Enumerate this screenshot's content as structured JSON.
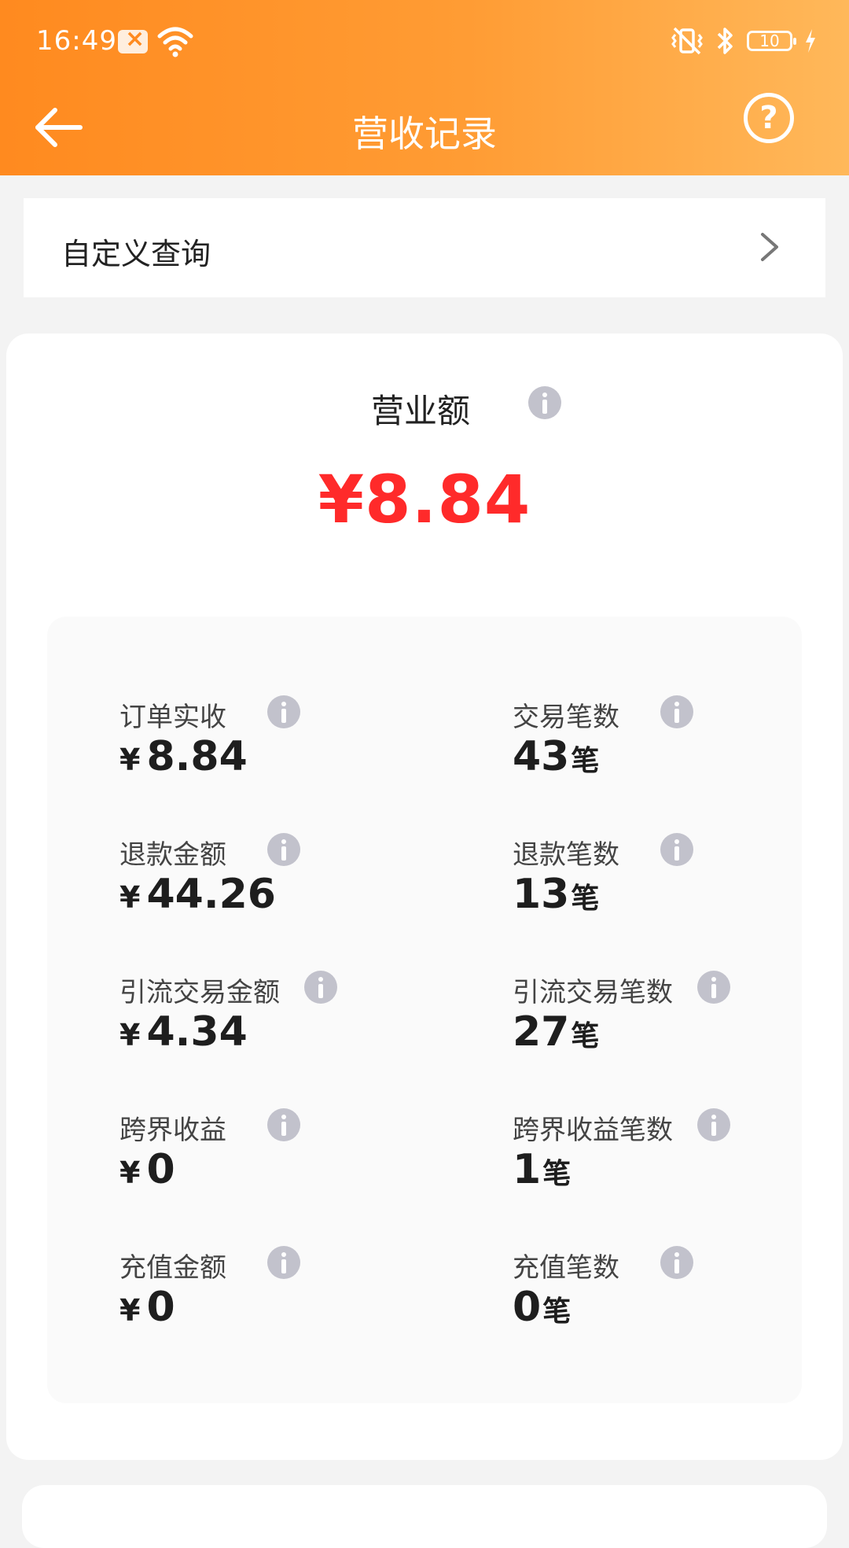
{
  "status_bar": {
    "time": "16:49",
    "battery_level": "10"
  },
  "header": {
    "title": "营收记录",
    "help_label": "?"
  },
  "custom_query": {
    "label": "自定义查询"
  },
  "revenue": {
    "title": "营业额",
    "amount": "¥8.84"
  },
  "stats": {
    "left": [
      {
        "label": "订单实收",
        "yen": "¥",
        "value": "8.84"
      },
      {
        "label": "退款金额",
        "yen": "¥",
        "value": "44.26"
      },
      {
        "label": "引流交易金额",
        "yen": "¥",
        "value": "4.34"
      },
      {
        "label": "跨界收益",
        "yen": "¥",
        "value": "0"
      },
      {
        "label": "充值金额",
        "yen": "¥",
        "value": "0"
      }
    ],
    "right": [
      {
        "label": "交易笔数",
        "value": "43",
        "unit": "笔"
      },
      {
        "label": "退款笔数",
        "value": "13",
        "unit": "笔"
      },
      {
        "label": "引流交易笔数",
        "value": "27",
        "unit": "笔"
      },
      {
        "label": "跨界收益笔数",
        "value": "1",
        "unit": "笔"
      },
      {
        "label": "充值笔数",
        "value": "0",
        "unit": "笔"
      }
    ]
  },
  "colors": {
    "header_start": "#ff8a1f",
    "header_end": "#ffb85a",
    "revenue_amount": "#ff2a2a",
    "info_icon": "#c2c2cc"
  }
}
